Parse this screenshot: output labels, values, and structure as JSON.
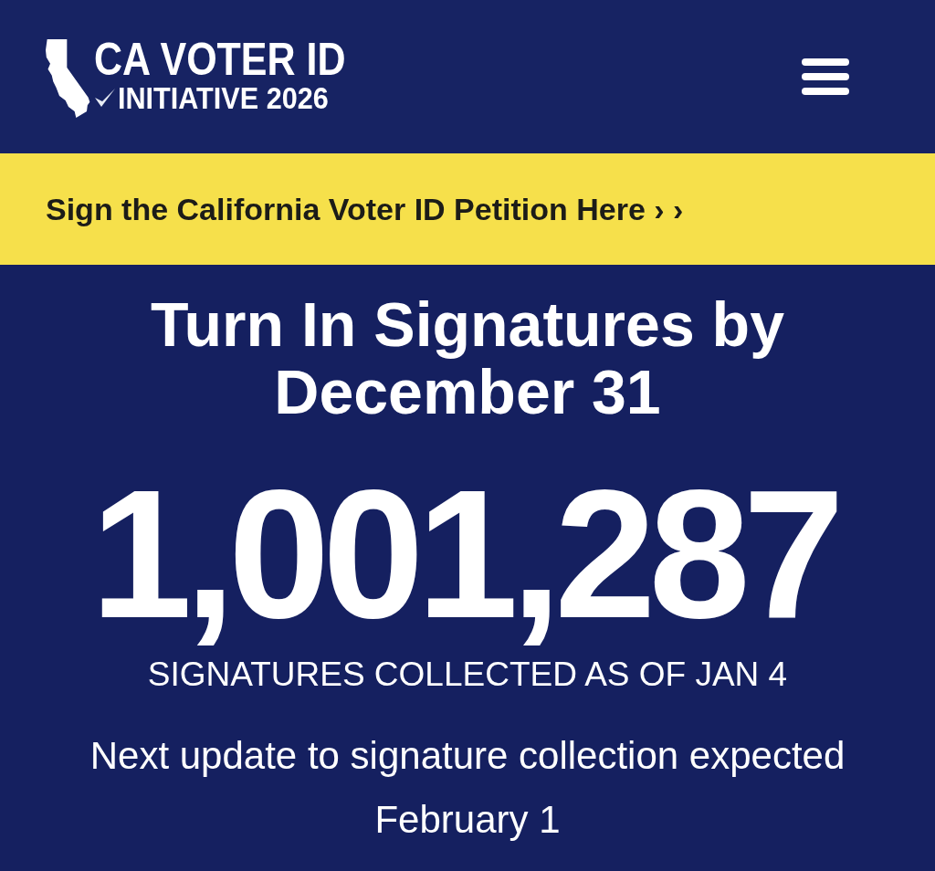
{
  "header": {
    "logo": {
      "title": "CA VOTER ID",
      "subtitle": "INITIATIVE 2026"
    }
  },
  "banner": {
    "link": "Sign the California Voter ID Petition Here › ›"
  },
  "hero": {
    "headline": "Turn In Signatures by December 31",
    "count": "1,001,287",
    "count_caption": "SIGNATURES COLLECTED AS OF JAN 4",
    "note": "Next update to signature collection expected February 1"
  }
}
